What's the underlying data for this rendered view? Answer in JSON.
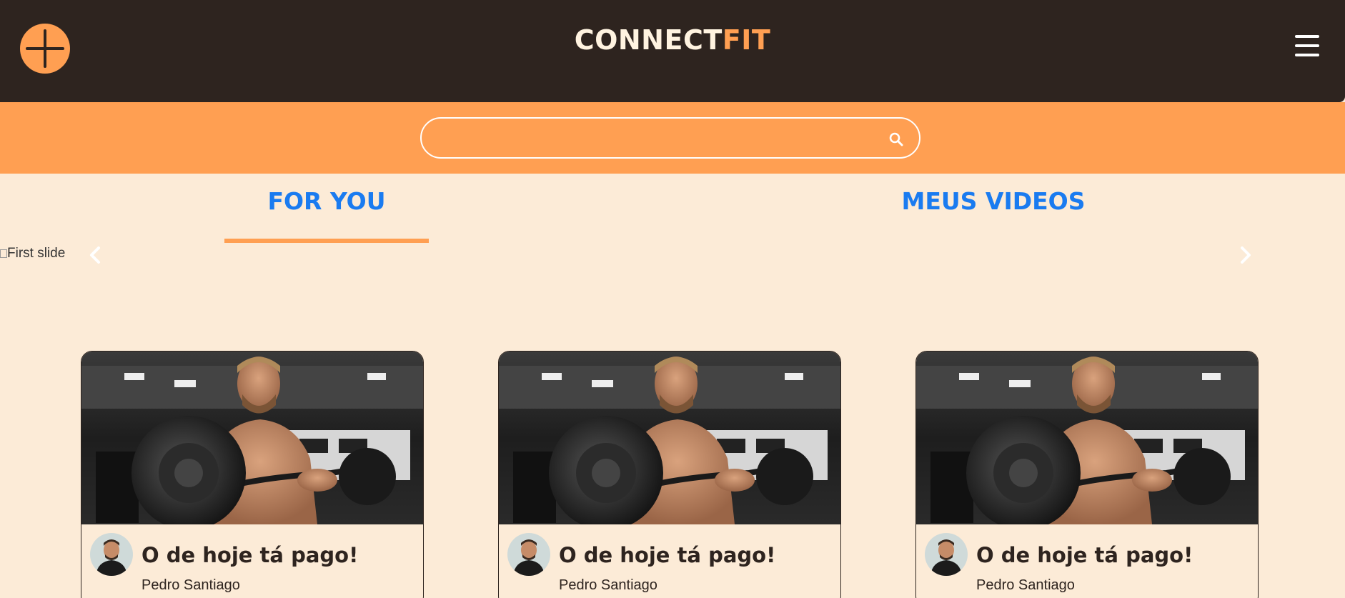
{
  "header": {
    "brand_main": "CONNECT",
    "brand_accent": "FIT",
    "add_icon": "plus-icon",
    "menu_icon": "hamburger-menu-icon"
  },
  "search": {
    "placeholder": "",
    "value": "",
    "icon": "search-icon"
  },
  "tabs": [
    {
      "label": "FOR YOU",
      "active": true
    },
    {
      "label": "MEUS VIDEOS",
      "active": false
    }
  ],
  "carousel": {
    "slide_alt": "First slide",
    "prev_icon": "chevron-left-icon",
    "next_icon": "chevron-right-icon"
  },
  "videos": [
    {
      "title": "O de hoje tá pago!",
      "author": "Pedro Santiago"
    },
    {
      "title": "O de hoje tá pago!",
      "author": "Pedro Santiago"
    },
    {
      "title": "O de hoje tá pago!",
      "author": "Pedro Santiago"
    }
  ],
  "colors": {
    "header_bg": "#2e241f",
    "accent": "#ff9f52",
    "page_bg": "#fcebd7",
    "tab_text": "#1a7bf0"
  }
}
